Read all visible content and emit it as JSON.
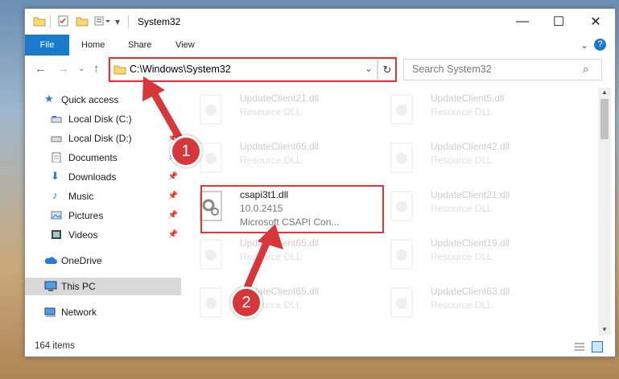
{
  "window": {
    "title": "System32"
  },
  "ribbon": {
    "tabs": [
      "File",
      "Home",
      "Share",
      "View"
    ]
  },
  "address": {
    "path": "C:\\Windows\\System32",
    "search_placeholder": "Search System32"
  },
  "sidebar": {
    "items": [
      {
        "label": "Quick access",
        "icon": "star-icon"
      },
      {
        "label": "Local Disk (C:)",
        "icon": "drive-icon"
      },
      {
        "label": "Local Disk (D:)",
        "icon": "drive-icon"
      },
      {
        "label": "Documents",
        "icon": "documents-icon"
      },
      {
        "label": "Downloads",
        "icon": "download-icon"
      },
      {
        "label": "Music",
        "icon": "music-icon"
      },
      {
        "label": "Pictures",
        "icon": "pictures-icon"
      },
      {
        "label": "Videos",
        "icon": "videos-icon"
      },
      {
        "label": "OneDrive",
        "icon": "cloud-icon"
      },
      {
        "label": "This PC",
        "icon": "pc-icon"
      },
      {
        "label": "Network",
        "icon": "network-icon"
      }
    ]
  },
  "files": [
    {
      "name": "UpdateClient21.dll",
      "type": "Resource DLL"
    },
    {
      "name": "UpdateClient5.dll",
      "type": "Resource DLL"
    },
    {
      "name": "UpdateClient65.dll",
      "type": "Resource DLL"
    },
    {
      "name": "UpdateClient42.dll",
      "type": "Resource DLL"
    },
    {
      "name": "csapi3t1.dll",
      "version": "10.0.2415",
      "type": "Microsoft CSAPI Con..."
    },
    {
      "name": "UpdateClient21.dll",
      "type": "Resource DLL"
    },
    {
      "name": "UpdateClient65.dll",
      "type": "Resource DLL"
    },
    {
      "name": "UpdateClient19.dll",
      "type": "Resource DLL"
    },
    {
      "name": "UpdateClient65.dll",
      "type": "Resource DLL"
    },
    {
      "name": "UpdateClient63.dll",
      "type": "Resource DLL"
    }
  ],
  "status": {
    "items_count": "164 items"
  },
  "annotations": {
    "step1": "1",
    "step2": "2"
  },
  "colors": {
    "accent": "#1979ca",
    "highlight": "#e0353b"
  }
}
